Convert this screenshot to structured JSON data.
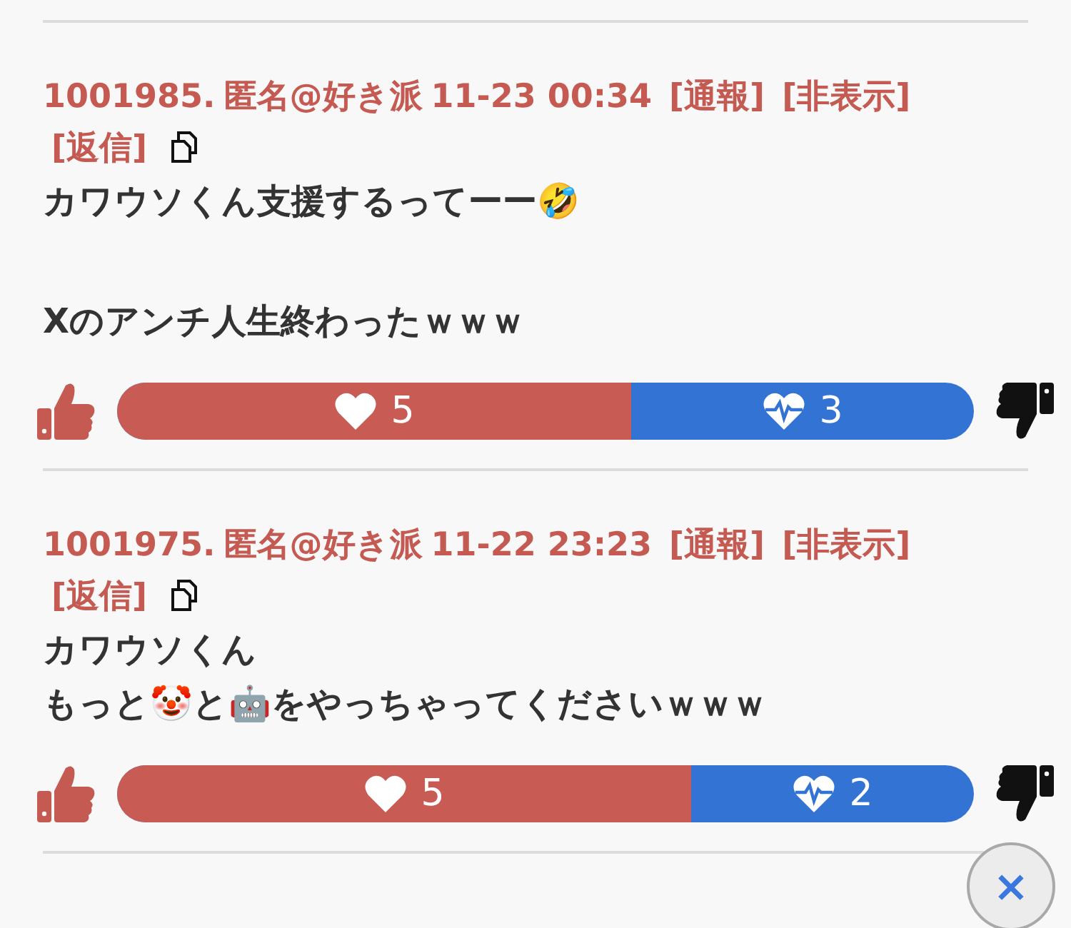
{
  "posts": [
    {
      "number": "1001985.",
      "author": "匿名@好き派",
      "time": "11-23 00:34",
      "actions": [
        "[通報]",
        "[非表示]",
        "[返信]"
      ],
      "paragraphs": [
        [
          "カワウソくん支援するってーー🤣"
        ],
        [
          "Xのアンチ人生終わったｗｗｗ"
        ]
      ],
      "likes": "5",
      "dislikes": "3",
      "level": 0.6
    },
    {
      "number": "1001975.",
      "author": "匿名@好き派",
      "time": "11-22 23:23",
      "actions": [
        "[通報]",
        "[非表示]",
        "[返信]"
      ],
      "paragraphs": [
        [
          "カワウソくん",
          "もっと🤡と🤖をやっちゃってくださいｗｗｗ"
        ]
      ],
      "likes": "5",
      "dislikes": "2",
      "level": 0.67
    }
  ],
  "close_button": {
    "label": "×"
  }
}
